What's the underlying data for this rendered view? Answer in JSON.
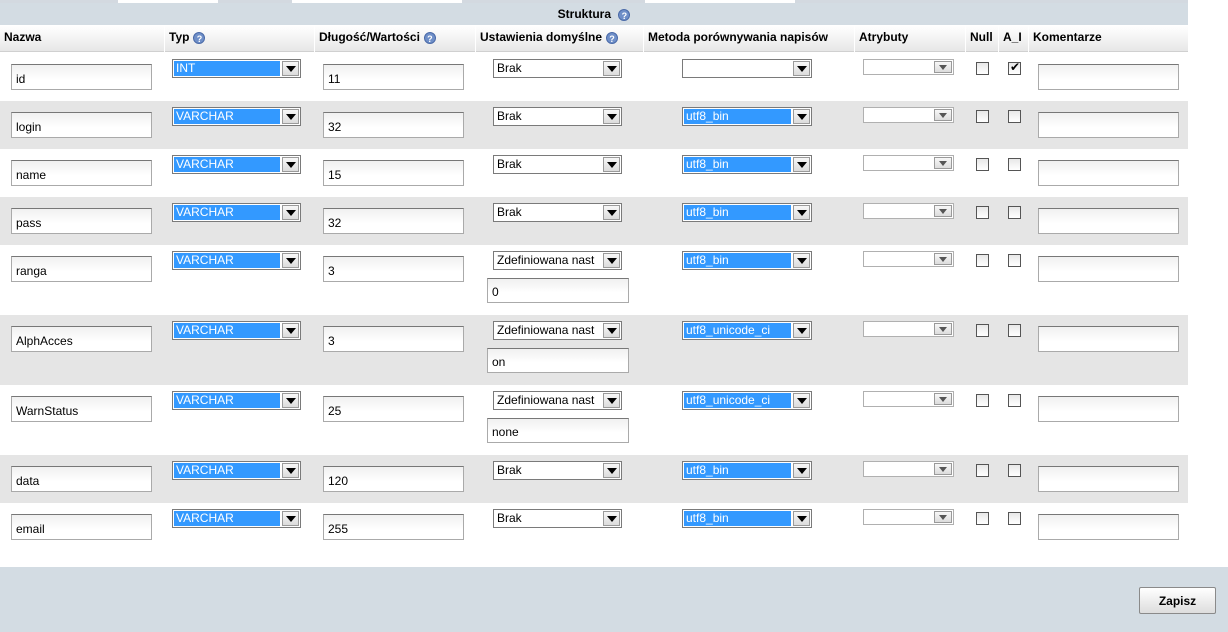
{
  "section_title": "Struktura",
  "headers": {
    "name": "Nazwa",
    "type": "Typ",
    "length": "Długość/Wartości",
    "default": "Ustawienia domyślne",
    "collation": "Metoda porównywania napisów",
    "attributes": "Atrybuty",
    "null": "Null",
    "ai": "A_I",
    "comments": "Komentarze"
  },
  "help_icon_glyph": "?",
  "rows": [
    {
      "name": "id",
      "type": "INT",
      "length": "11",
      "default": "Brak",
      "default_value": null,
      "collation": "",
      "attributes": "",
      "null": false,
      "ai": true,
      "comment": ""
    },
    {
      "name": "login",
      "type": "VARCHAR",
      "length": "32",
      "default": "Brak",
      "default_value": null,
      "collation": "utf8_bin",
      "attributes": "",
      "null": false,
      "ai": false,
      "comment": ""
    },
    {
      "name": "name",
      "type": "VARCHAR",
      "length": "15",
      "default": "Brak",
      "default_value": null,
      "collation": "utf8_bin",
      "attributes": "",
      "null": false,
      "ai": false,
      "comment": ""
    },
    {
      "name": "pass",
      "type": "VARCHAR",
      "length": "32",
      "default": "Brak",
      "default_value": null,
      "collation": "utf8_bin",
      "attributes": "",
      "null": false,
      "ai": false,
      "comment": ""
    },
    {
      "name": "ranga",
      "type": "VARCHAR",
      "length": "3",
      "default": "Zdefiniowana nast",
      "default_value": "0",
      "collation": "utf8_bin",
      "attributes": "",
      "null": false,
      "ai": false,
      "comment": ""
    },
    {
      "name": "AlphAcces",
      "type": "VARCHAR",
      "length": "3",
      "default": "Zdefiniowana nast",
      "default_value": "on",
      "collation": "utf8_unicode_ci",
      "attributes": "",
      "null": false,
      "ai": false,
      "comment": ""
    },
    {
      "name": "WarnStatus",
      "type": "VARCHAR",
      "length": "25",
      "default": "Zdefiniowana nast",
      "default_value": "none",
      "collation": "utf8_unicode_ci",
      "attributes": "",
      "null": false,
      "ai": false,
      "comment": ""
    },
    {
      "name": "data",
      "type": "VARCHAR",
      "length": "120",
      "default": "Brak",
      "default_value": null,
      "collation": "utf8_bin",
      "attributes": "",
      "null": false,
      "ai": false,
      "comment": ""
    },
    {
      "name": "email",
      "type": "VARCHAR",
      "length": "255",
      "default": "Brak",
      "default_value": null,
      "collation": "utf8_bin",
      "attributes": "",
      "null": false,
      "ai": false,
      "comment": ""
    }
  ],
  "save_label": "Zapisz",
  "colors": {
    "header_bg": "#d3dce3",
    "row_alt": "#e5e5e5",
    "select_highlight": "#3399ff"
  }
}
